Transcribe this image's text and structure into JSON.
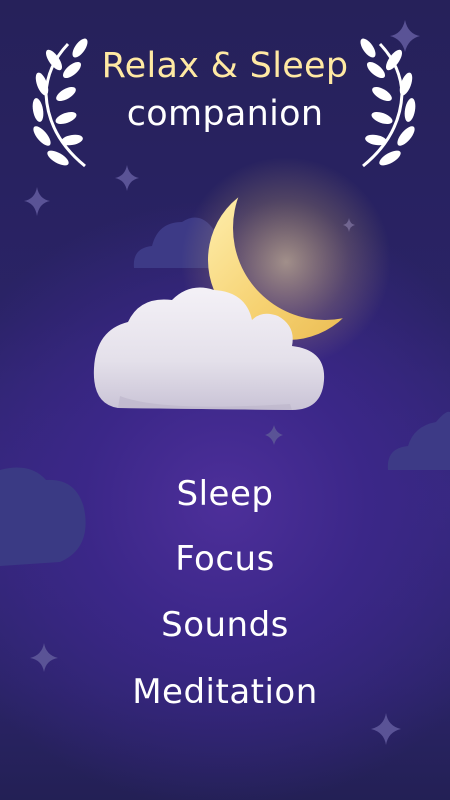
{
  "header": {
    "title_line1": "Relax & Sleep",
    "title_line2": "companion"
  },
  "menu": {
    "items": [
      {
        "label": "Sleep"
      },
      {
        "label": "Focus"
      },
      {
        "label": "Sounds"
      },
      {
        "label": "Meditation"
      }
    ]
  },
  "icons": {
    "left_wreath": "laurel-branch-icon",
    "right_wreath": "laurel-branch-icon",
    "moon": "crescent-moon-icon",
    "cloud": "cloud-icon",
    "stars": "sparkle-star-icon"
  },
  "colors": {
    "background": "#2a2366",
    "title_accent": "#ffe9a3",
    "text": "#ffffff",
    "moon": "#f7d77b",
    "cloud": "#e8e4ef"
  }
}
